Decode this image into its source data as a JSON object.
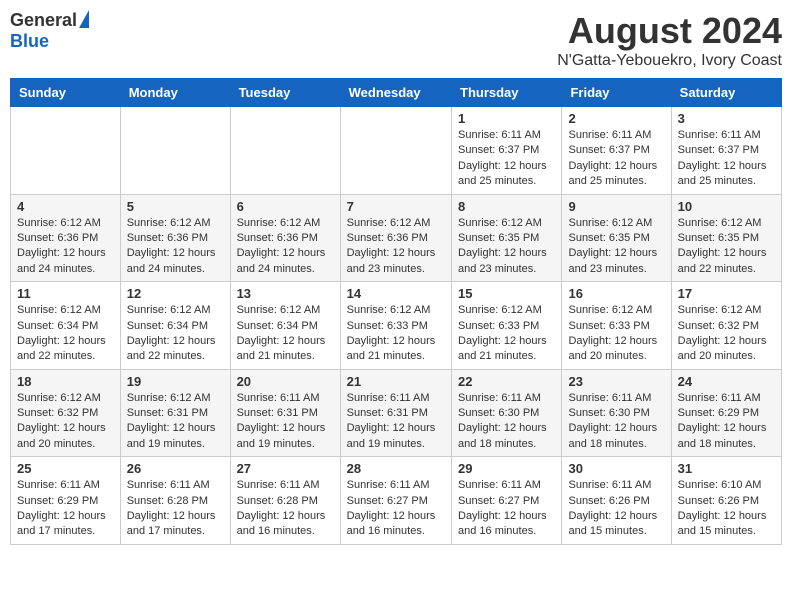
{
  "header": {
    "logo_general": "General",
    "logo_blue": "Blue",
    "main_title": "August 2024",
    "subtitle": "N'Gatta-Yebouekro, Ivory Coast"
  },
  "calendar": {
    "days_of_week": [
      "Sunday",
      "Monday",
      "Tuesday",
      "Wednesday",
      "Thursday",
      "Friday",
      "Saturday"
    ],
    "weeks": [
      [
        {
          "day": "",
          "info": ""
        },
        {
          "day": "",
          "info": ""
        },
        {
          "day": "",
          "info": ""
        },
        {
          "day": "",
          "info": ""
        },
        {
          "day": "1",
          "info": "Sunrise: 6:11 AM\nSunset: 6:37 PM\nDaylight: 12 hours\nand 25 minutes."
        },
        {
          "day": "2",
          "info": "Sunrise: 6:11 AM\nSunset: 6:37 PM\nDaylight: 12 hours\nand 25 minutes."
        },
        {
          "day": "3",
          "info": "Sunrise: 6:11 AM\nSunset: 6:37 PM\nDaylight: 12 hours\nand 25 minutes."
        }
      ],
      [
        {
          "day": "4",
          "info": "Sunrise: 6:12 AM\nSunset: 6:36 PM\nDaylight: 12 hours\nand 24 minutes."
        },
        {
          "day": "5",
          "info": "Sunrise: 6:12 AM\nSunset: 6:36 PM\nDaylight: 12 hours\nand 24 minutes."
        },
        {
          "day": "6",
          "info": "Sunrise: 6:12 AM\nSunset: 6:36 PM\nDaylight: 12 hours\nand 24 minutes."
        },
        {
          "day": "7",
          "info": "Sunrise: 6:12 AM\nSunset: 6:36 PM\nDaylight: 12 hours\nand 23 minutes."
        },
        {
          "day": "8",
          "info": "Sunrise: 6:12 AM\nSunset: 6:35 PM\nDaylight: 12 hours\nand 23 minutes."
        },
        {
          "day": "9",
          "info": "Sunrise: 6:12 AM\nSunset: 6:35 PM\nDaylight: 12 hours\nand 23 minutes."
        },
        {
          "day": "10",
          "info": "Sunrise: 6:12 AM\nSunset: 6:35 PM\nDaylight: 12 hours\nand 22 minutes."
        }
      ],
      [
        {
          "day": "11",
          "info": "Sunrise: 6:12 AM\nSunset: 6:34 PM\nDaylight: 12 hours\nand 22 minutes."
        },
        {
          "day": "12",
          "info": "Sunrise: 6:12 AM\nSunset: 6:34 PM\nDaylight: 12 hours\nand 22 minutes."
        },
        {
          "day": "13",
          "info": "Sunrise: 6:12 AM\nSunset: 6:34 PM\nDaylight: 12 hours\nand 21 minutes."
        },
        {
          "day": "14",
          "info": "Sunrise: 6:12 AM\nSunset: 6:33 PM\nDaylight: 12 hours\nand 21 minutes."
        },
        {
          "day": "15",
          "info": "Sunrise: 6:12 AM\nSunset: 6:33 PM\nDaylight: 12 hours\nand 21 minutes."
        },
        {
          "day": "16",
          "info": "Sunrise: 6:12 AM\nSunset: 6:33 PM\nDaylight: 12 hours\nand 20 minutes."
        },
        {
          "day": "17",
          "info": "Sunrise: 6:12 AM\nSunset: 6:32 PM\nDaylight: 12 hours\nand 20 minutes."
        }
      ],
      [
        {
          "day": "18",
          "info": "Sunrise: 6:12 AM\nSunset: 6:32 PM\nDaylight: 12 hours\nand 20 minutes."
        },
        {
          "day": "19",
          "info": "Sunrise: 6:12 AM\nSunset: 6:31 PM\nDaylight: 12 hours\nand 19 minutes."
        },
        {
          "day": "20",
          "info": "Sunrise: 6:11 AM\nSunset: 6:31 PM\nDaylight: 12 hours\nand 19 minutes."
        },
        {
          "day": "21",
          "info": "Sunrise: 6:11 AM\nSunset: 6:31 PM\nDaylight: 12 hours\nand 19 minutes."
        },
        {
          "day": "22",
          "info": "Sunrise: 6:11 AM\nSunset: 6:30 PM\nDaylight: 12 hours\nand 18 minutes."
        },
        {
          "day": "23",
          "info": "Sunrise: 6:11 AM\nSunset: 6:30 PM\nDaylight: 12 hours\nand 18 minutes."
        },
        {
          "day": "24",
          "info": "Sunrise: 6:11 AM\nSunset: 6:29 PM\nDaylight: 12 hours\nand 18 minutes."
        }
      ],
      [
        {
          "day": "25",
          "info": "Sunrise: 6:11 AM\nSunset: 6:29 PM\nDaylight: 12 hours\nand 17 minutes."
        },
        {
          "day": "26",
          "info": "Sunrise: 6:11 AM\nSunset: 6:28 PM\nDaylight: 12 hours\nand 17 minutes."
        },
        {
          "day": "27",
          "info": "Sunrise: 6:11 AM\nSunset: 6:28 PM\nDaylight: 12 hours\nand 16 minutes."
        },
        {
          "day": "28",
          "info": "Sunrise: 6:11 AM\nSunset: 6:27 PM\nDaylight: 12 hours\nand 16 minutes."
        },
        {
          "day": "29",
          "info": "Sunrise: 6:11 AM\nSunset: 6:27 PM\nDaylight: 12 hours\nand 16 minutes."
        },
        {
          "day": "30",
          "info": "Sunrise: 6:11 AM\nSunset: 6:26 PM\nDaylight: 12 hours\nand 15 minutes."
        },
        {
          "day": "31",
          "info": "Sunrise: 6:10 AM\nSunset: 6:26 PM\nDaylight: 12 hours\nand 15 minutes."
        }
      ]
    ]
  }
}
